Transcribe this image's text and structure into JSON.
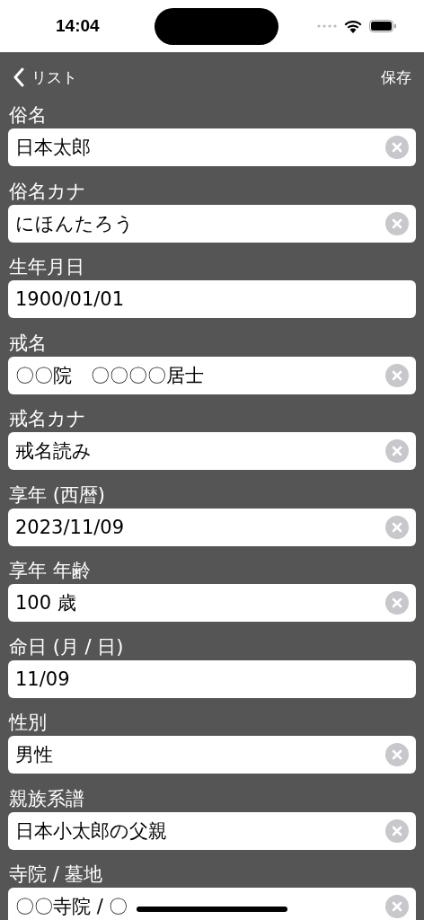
{
  "status_bar": {
    "time": "14:04"
  },
  "nav": {
    "back_label": "リスト",
    "action": "保存"
  },
  "fields": [
    {
      "label": "俗名",
      "value": "日本太郎",
      "clearable": true
    },
    {
      "label": "俗名カナ",
      "value": "にほんたろう",
      "clearable": true
    },
    {
      "label": "生年月日",
      "value": "1900/01/01",
      "clearable": false
    },
    {
      "label": "戒名",
      "value": "〇〇院　〇〇〇〇居士",
      "clearable": true
    },
    {
      "label": "戒名カナ",
      "value": "戒名読み",
      "clearable": true
    },
    {
      "label": "享年 (西暦)",
      "value": "2023/11/09",
      "clearable": true
    },
    {
      "label": "享年 年齢",
      "value": "100 歳",
      "clearable": true
    },
    {
      "label": "命日 (月 / 日)",
      "value": "11/09",
      "clearable": false
    },
    {
      "label": "性別",
      "value": "男性",
      "clearable": true
    },
    {
      "label": "親族系譜",
      "value": "日本小太郎の父親",
      "clearable": true
    },
    {
      "label": "寺院 / 墓地",
      "value": "〇〇寺院 / 〇",
      "clearable": true
    }
  ]
}
